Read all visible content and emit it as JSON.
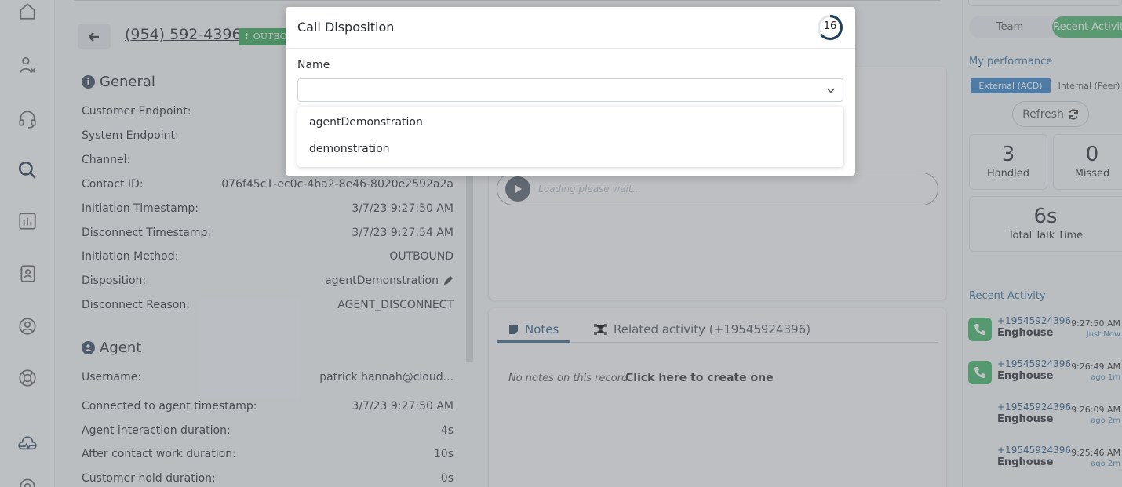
{
  "call": {
    "phone": "(954) 592-4396",
    "direction_badge": "⇡ OUTBOUND"
  },
  "general": {
    "heading": "General",
    "rows": [
      {
        "label": "Customer Endpoint:",
        "value": ""
      },
      {
        "label": "System Endpoint:",
        "value": ""
      },
      {
        "label": "Channel:",
        "value": ""
      },
      {
        "label": "Contact ID:",
        "value": "076f45c1-ec0c-4ba2-8e46-8020e2592a2a"
      },
      {
        "label": "Initiation Timestamp:",
        "value": "3/7/23 9:27:50 AM"
      },
      {
        "label": "Disconnect Timestamp:",
        "value": "3/7/23 9:27:54 AM"
      },
      {
        "label": "Initiation Method:",
        "value": "OUTBOUND"
      },
      {
        "label": "Disposition:",
        "value": "agentDemonstration"
      },
      {
        "label": "Disconnect Reason:",
        "value": "AGENT_DISCONNECT"
      }
    ]
  },
  "agent": {
    "heading": "Agent",
    "rows": [
      {
        "label": "Username:",
        "value": "patrick.hannah@cloud..."
      },
      {
        "label": "Connected to agent timestamp:",
        "value": "3/7/23 9:27:50 AM"
      },
      {
        "label": "Agent interaction duration:",
        "value": "4s"
      },
      {
        "label": "After contact work duration:",
        "value": "10s"
      },
      {
        "label": "Customer hold duration:",
        "value": "0s"
      }
    ]
  },
  "recording": {
    "status": "Loading please wait..."
  },
  "notes": {
    "tab_notes": "Notes",
    "tab_related": "Related activity (+19545924396)",
    "empty_text": "No notes on this record",
    "create_link": "Click here to create one"
  },
  "right_panel": {
    "tab_team": "Team",
    "tab_recent": "Recent Activity",
    "perf_title": "My performance",
    "toggle_external": "External (ACD)",
    "toggle_internal": "Internal (Peer)",
    "refresh_label": "Refresh",
    "stats": {
      "handled_value": "3",
      "handled_label": "Handled",
      "missed_value": "0",
      "missed_label": "Missed",
      "talk_value": "6s",
      "talk_label": "Total Talk Time"
    },
    "recent_title": "Recent Activity",
    "activities": [
      {
        "number": "+19545924396",
        "name": "Enghouse",
        "time": "9:27:50 AM",
        "ago": "Just Now",
        "icon": true
      },
      {
        "number": "+19545924396",
        "name": "Enghouse",
        "time": "9:26:49 AM",
        "ago": "ago 1m",
        "icon": true
      },
      {
        "number": "+19545924396",
        "name": "Enghouse",
        "time": "9:26:09 AM",
        "ago": "ago 2m",
        "icon": false
      },
      {
        "number": "+19545924396",
        "name": "Enghouse",
        "time": "9:25:46 AM",
        "ago": "ago 2m",
        "icon": false
      }
    ]
  },
  "modal": {
    "title": "Call Disposition",
    "countdown": "16",
    "field_label": "Name",
    "selected_value": "",
    "options": [
      "agentDemonstration",
      "demonstration"
    ]
  },
  "colors": {
    "accent": "#3570a0",
    "badge_green": "#3aa55c",
    "timer_ring": "#1f3f5a"
  }
}
